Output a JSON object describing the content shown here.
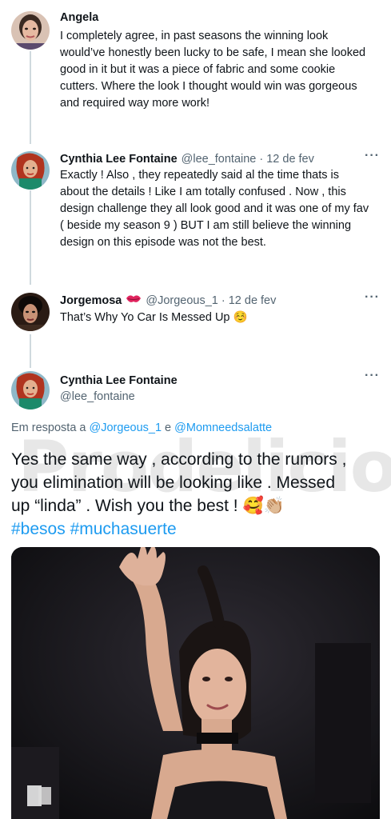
{
  "tweets": [
    {
      "name": "Angela",
      "lines": [
        "I completely agree, in past seasons the winning look",
        "would’ve honestly been lucky to be safe, I mean she looked",
        "good in it but it was a piece of fabric and some cookie",
        "cutters. Where the look I thought would win was gorgeous",
        "and required way more work!"
      ]
    },
    {
      "name": "Cynthia Lee Fontaine",
      "handle": "@lee_fontaine",
      "separator": "·",
      "date": "12 de fev",
      "more": "···",
      "lines": [
        "Exactly ! Also , they repeatedly said al the time thats is",
        "about the details ! Like I am totally confused . Now , this",
        "design challenge they all look good and it was one of my fav",
        "( beside my  season 9 ) BUT I am still believe the winning",
        "design on this episode was not the best."
      ]
    },
    {
      "name": "Jorgemosa",
      "handle": "@Jorgeous_1",
      "separator": "·",
      "date": "12 de fev",
      "more": "···",
      "lines": [
        "That’s Why Yo Car Is Messed Up ☺️"
      ]
    }
  ],
  "main_tweet": {
    "name": "Cynthia Lee Fontaine",
    "handle": "@lee_fontaine",
    "more": "···",
    "reply_prefix": "Em resposta a ",
    "reply_user1": "@Jorgeous_1",
    "reply_and": " e ",
    "reply_user2": "@Momneedsalatte",
    "lines": [
      "Yes the same way , according to the rumors ,",
      "you elimination will be looking like . Messed",
      "up “linda” .  Wish you the best ! 🥰👏🏼"
    ],
    "hashtags": [
      "#besos",
      "#muchasuerte"
    ]
  },
  "watermark_text": "Prodelicious",
  "icons": {
    "lips": "kiss-mark-icon",
    "more": "more-options-icon"
  },
  "colors": {
    "link": "#1d9bf0",
    "secondary": "#536471",
    "thread_line": "#cfd9de"
  }
}
